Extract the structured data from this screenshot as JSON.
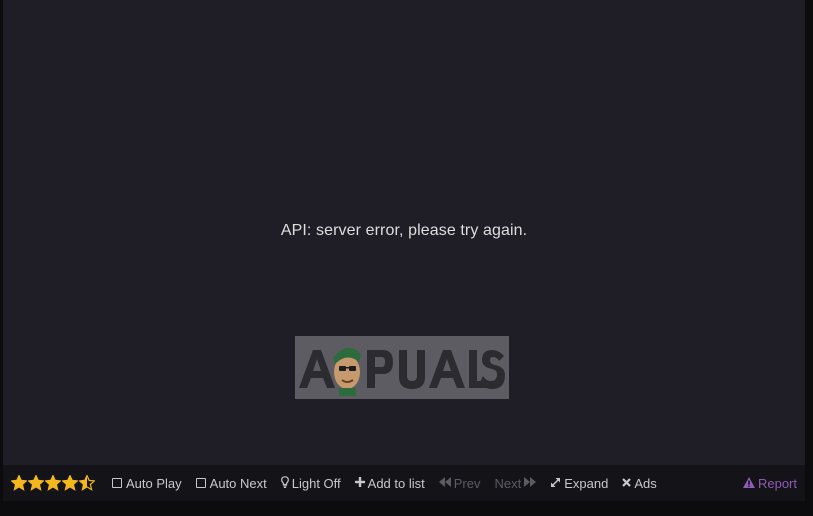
{
  "player": {
    "error_message": "API: server error, please try again."
  },
  "watermark": {
    "brand_text": "APPUALS"
  },
  "rating": {
    "stars": 4.5,
    "max": 5,
    "color": "#f5b81c"
  },
  "controls": {
    "auto_play": "Auto Play",
    "auto_next": "Auto Next",
    "light_off": "Light Off",
    "add_to_list": "Add to list",
    "prev": "Prev",
    "next": "Next",
    "expand": "Expand",
    "ads": "Ads",
    "report": "Report"
  },
  "colors": {
    "background": "#1f1e26",
    "bar": "#141318",
    "report": "#8e5bb6",
    "disabled": "#5b5b62"
  },
  "icons": {
    "checkbox": "checkbox-icon",
    "bulb": "lightbulb-icon",
    "plus": "plus-icon",
    "prev": "backward-icon",
    "next": "forward-icon",
    "expand": "expand-icon",
    "close": "close-icon",
    "warning": "warning-icon"
  }
}
